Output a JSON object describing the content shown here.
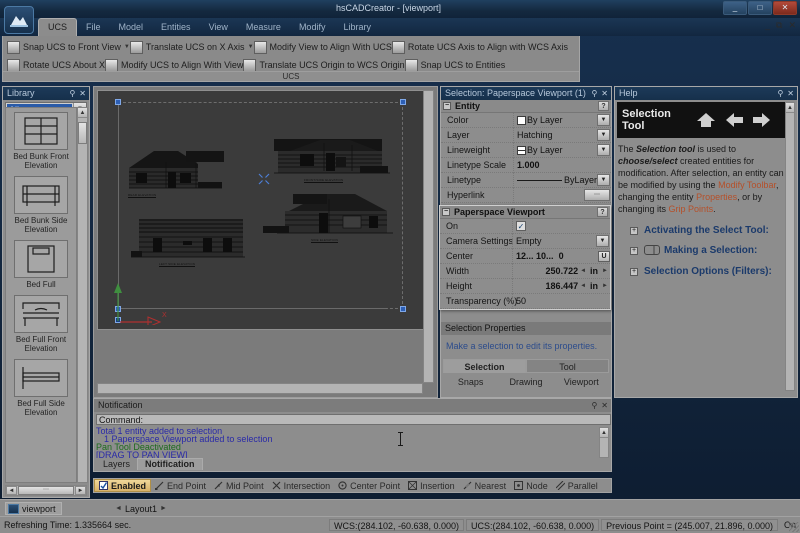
{
  "window": {
    "title": "hsCADCreator - [viewport]",
    "buttons": {
      "minimize": "_",
      "maximize": "□",
      "close": "✕"
    },
    "mdi_buttons": {
      "minimize": "_",
      "restore": "⧉",
      "close": "✕"
    }
  },
  "ribbon_tabs": [
    {
      "label": "UCS",
      "active": true
    },
    {
      "label": "File",
      "active": false
    },
    {
      "label": "Model",
      "active": false
    },
    {
      "label": "Entities",
      "active": false
    },
    {
      "label": "View",
      "active": false
    },
    {
      "label": "Measure",
      "active": false
    },
    {
      "label": "Modify",
      "active": false
    },
    {
      "label": "Library",
      "active": false
    }
  ],
  "ribbon": {
    "group_caption": "UCS",
    "row1": [
      {
        "label": "Snap UCS to Front View",
        "icon": "snap-ucs-front-view-icon",
        "has_caret": true
      },
      {
        "label": "Translate UCS on X Axis",
        "icon": "translate-ucs-x-axis-icon",
        "has_caret": true
      },
      {
        "label": "Modify View to Align With UCS",
        "icon": "modify-view-align-ucs-icon",
        "has_caret": false
      },
      {
        "label": "Rotate UCS Axis to Align with WCS Axis",
        "icon": "rotate-ucs-axis-wcs-icon",
        "has_caret": false
      }
    ],
    "row2": [
      {
        "label": "Rotate UCS About X",
        "icon": "rotate-ucs-about-x-icon",
        "has_caret": false
      },
      {
        "label": "Modify UCS to Align With View",
        "icon": "modify-ucs-align-view-icon",
        "has_caret": false
      },
      {
        "label": "Translate UCS Origin to WCS Origin",
        "icon": "translate-ucs-origin-wcs-icon",
        "has_caret": false
      },
      {
        "label": "Snap UCS to Entities",
        "icon": "snap-ucs-entities-icon",
        "has_caret": false
      }
    ]
  },
  "library": {
    "title": "Library",
    "pin": "⚲",
    "close": "✕",
    "filter_value": "All",
    "items": [
      {
        "label": "Bed Bunk Front Elevation",
        "thumb": "bunk-bed-front-thumb"
      },
      {
        "label": "Bed Bunk Side Elevation",
        "thumb": "bunk-bed-side-thumb"
      },
      {
        "label": "Bed Full",
        "thumb": "bed-full-thumb"
      },
      {
        "label": "Bed Full Front Elevation",
        "thumb": "bed-full-front-thumb"
      },
      {
        "label": "Bed Full Side Elevation",
        "thumb": "bed-full-side-thumb"
      }
    ]
  },
  "canvas": {
    "drawing_labels": [
      "REAR ELEVATION",
      "FRONT/SIDE ELEVATION",
      "LEFT SIDE ELEVATION",
      "SIDE ELEVATION"
    ],
    "axis_x_label": "X",
    "axis_y_label": "Y"
  },
  "properties": {
    "title": "Selection: Paperspace Viewport (1)",
    "pin": "⚲",
    "close": "✕",
    "entity": {
      "group_label": "Entity",
      "expander": "−",
      "help_chip": "?",
      "rows": [
        {
          "name": "Color",
          "value": "By Layer",
          "kind": "color-dropdown"
        },
        {
          "name": "Layer",
          "value": "Hatching",
          "kind": "dropdown"
        },
        {
          "name": "Lineweight",
          "value": "By Layer",
          "kind": "lineweight-dropdown"
        },
        {
          "name": "Linetype Scale",
          "value": "1.000",
          "kind": "text-bold"
        },
        {
          "name": "Linetype",
          "value": "ByLayer",
          "kind": "linetype-dropdown"
        },
        {
          "name": "Hyperlink",
          "value": "",
          "kind": "button"
        }
      ]
    },
    "viewport": {
      "group_label": "Paperspace Viewport",
      "expander": "−",
      "help_chip": "?",
      "rows": [
        {
          "name": "On",
          "value": "✓",
          "kind": "checkbox"
        },
        {
          "name": "Camera Settings",
          "value": "Empty",
          "kind": "dropdown"
        },
        {
          "name": "Center",
          "value_x": "12...",
          "value_y": "10...",
          "value_z": "0",
          "unit_button": "U",
          "kind": "coords"
        },
        {
          "name": "Width",
          "value": "250.722",
          "unit": "in",
          "kind": "spinner"
        },
        {
          "name": "Height",
          "value": "186.447",
          "unit": "in",
          "kind": "spinner"
        },
        {
          "name": "Transparency (%)",
          "value": "50",
          "kind": "text"
        }
      ]
    },
    "selection_properties": {
      "header": "Selection Properties",
      "hint": "Make a selection to edit its properties.",
      "tabs_primary": [
        {
          "label": "Selection",
          "active": true
        },
        {
          "label": "Tool",
          "active": false
        }
      ],
      "tabs_secondary": [
        {
          "label": "Snaps"
        },
        {
          "label": "Drawing"
        },
        {
          "label": "Viewport"
        }
      ]
    }
  },
  "help": {
    "title": "Help",
    "pin": "⚲",
    "close": "✕",
    "banner_title": "Selection Tool",
    "nav_icons": [
      "home-icon",
      "back-arrow-icon",
      "forward-arrow-icon"
    ],
    "body": {
      "p1_a": "The ",
      "p1_b": "Selection tool",
      "p1_c": " is used to ",
      "p1_d": "choose/select",
      "p1_e": " created entities for modification. After selection, an entity can be modified by using the ",
      "link1": "Modify Toolbar",
      "p1_f": ", changing the entity ",
      "link2": "Properties",
      "p1_g": ", or by changing its ",
      "link3": "Grip Points",
      "p1_h": "."
    },
    "toc": [
      {
        "label": "Activating the Select Tool:",
        "expander": "+",
        "has_icon": false
      },
      {
        "label": "Making a Selection:",
        "expander": "+",
        "has_icon": true
      },
      {
        "label": "Selection Options (Filters):",
        "expander": "+",
        "has_icon": false
      }
    ]
  },
  "notification": {
    "title": "Notification",
    "pin": "⚲",
    "close": "✕",
    "command_label": "Command:",
    "log_lines": [
      {
        "text": "Total 1 entity added to selection",
        "color": "blue",
        "indent": false
      },
      {
        "text": "1 Paperspace Viewport added to selection",
        "color": "blue",
        "indent": true
      },
      {
        "text": "Pan Tool Deactivated",
        "color": "green",
        "indent": false
      },
      {
        "text": "[DRAG TO PAN VIEW]",
        "color": "blue",
        "indent": false
      }
    ],
    "tabs": [
      {
        "label": "Layers",
        "active": false
      },
      {
        "label": "Notification",
        "active": true
      }
    ]
  },
  "snapbar": {
    "items": [
      {
        "label": "Enabled",
        "icon": "snap-enabled-icon",
        "active": true
      },
      {
        "label": "End Point",
        "icon": "end-point-icon",
        "active": false
      },
      {
        "label": "Mid Point",
        "icon": "mid-point-icon",
        "active": false
      },
      {
        "label": "Intersection",
        "icon": "intersection-icon",
        "active": false
      },
      {
        "label": "Center Point",
        "icon": "center-point-icon",
        "active": false
      },
      {
        "label": "Insertion",
        "icon": "insertion-icon",
        "active": false
      },
      {
        "label": "Nearest",
        "icon": "nearest-icon",
        "active": false
      },
      {
        "label": "Node",
        "icon": "node-icon",
        "active": false
      },
      {
        "label": "Parallel",
        "icon": "parallel-icon",
        "active": false
      }
    ]
  },
  "layout_bar": {
    "active_tab": "viewport",
    "nav_prev": "◄",
    "nav_next": "►",
    "layout_name": "Layout1"
  },
  "statusbar": {
    "refresh": "Refreshing Time: 1.335664 sec.",
    "wcs": "WCS:(284.102, -60.638, 0.000)",
    "ucs": "UCS:(284.102, -60.638, 0.000)",
    "previous_point": "Previous Point = (245.007, 21.896, 0.000)",
    "ortho": "On"
  },
  "colors": {
    "titlebar": "#16304f",
    "panel_bg": "#8d8d8d",
    "canvas_bg": "#3b3b3b",
    "grip_blue": "#2d5fb5",
    "link_orange": "#b5502a",
    "log_blue": "#2a2aa8",
    "log_green": "#1d6b1d",
    "snap_active": "#d8b269"
  }
}
